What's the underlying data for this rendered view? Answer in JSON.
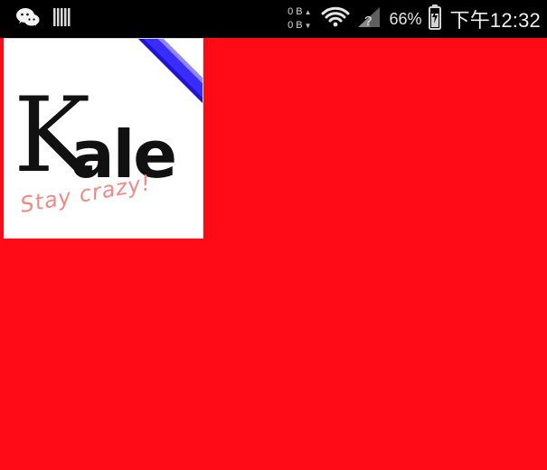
{
  "status_bar": {
    "left_icons": [
      "wechat-icon",
      "barcode-icon"
    ],
    "network_speed": {
      "upload": "0 B",
      "download": "0 B"
    },
    "battery_percent": "66%",
    "time": "下午12:32"
  },
  "app": {
    "background_color": "#ff0a16",
    "logo": {
      "wordmark": "Kale",
      "tagline": "Stay crazy!",
      "ribbon_color": "#3a2cff",
      "tagline_color": "#f08a87"
    }
  }
}
